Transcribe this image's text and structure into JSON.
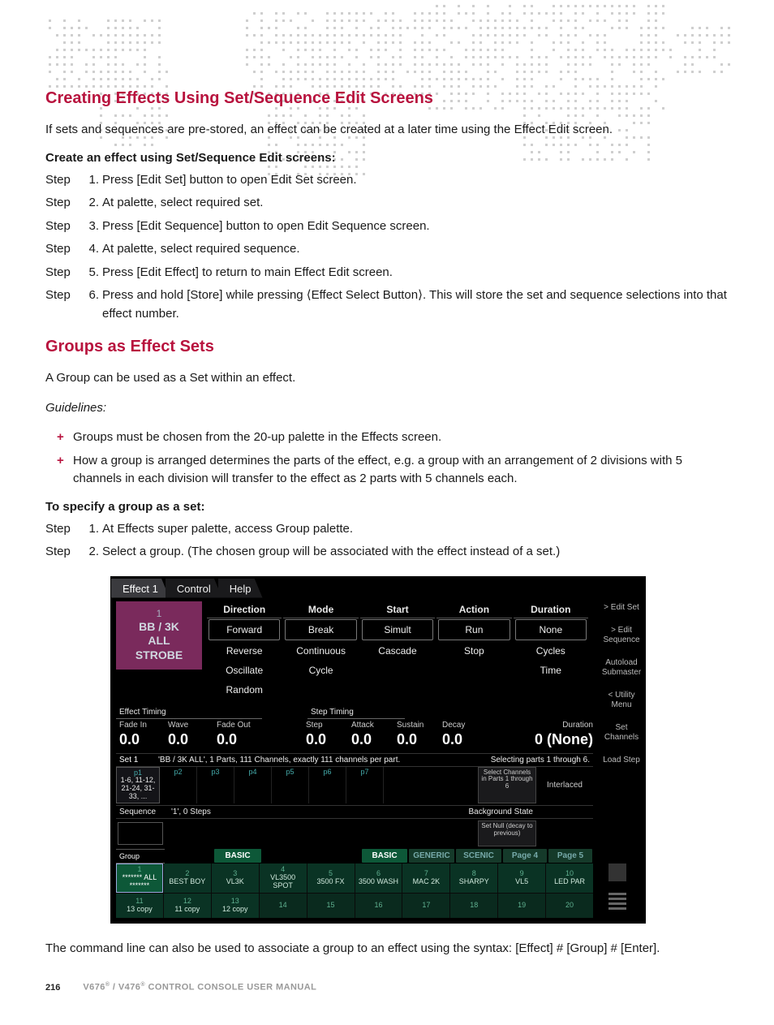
{
  "sections": {
    "h1": "Creating Effects Using Set/Sequence Edit Screens",
    "p1": "If sets and sequences are pre-stored, an effect can be created at a later time using the Effect Edit screen.",
    "sub1": "Create an effect using Set/Sequence Edit screens:",
    "steps1": [
      "Press [Edit Set] button to open Edit Set screen.",
      "At palette, select required set.",
      "Press [Edit Sequence] button to open Edit Sequence screen.",
      "At palette, select required sequence.",
      "Press [Edit Effect] to return to main Effect Edit screen.",
      "Press and hold [Store] while pressing ⟨Effect Select Button⟩. This will store the set and sequence selections into that effect number."
    ],
    "h2": "Groups as Effect Sets",
    "p2": "A Group can be used as a Set within an effect.",
    "guidelines_label": "Guidelines:",
    "bullets": [
      "Groups must be chosen from the 20-up palette in the Effects screen.",
      "How a group is arranged determines the parts of the effect, e.g. a group with an arrangement of 2 divisions with 5 channels in each division will transfer to the effect as 2 parts with 5 channels each."
    ],
    "sub2": "To specify a group as a set:",
    "steps2": [
      "At Effects super palette, access Group palette.",
      "Select a group. (The chosen group will be associated with the effect instead of a set.)"
    ],
    "closing": "The command line can also be used to associate a group to an effect using the syntax: [Effect] # [Group] # [Enter].",
    "step_label": "Step"
  },
  "shot": {
    "tabs": [
      "Effect 1",
      "Control",
      "Help"
    ],
    "effect_box": {
      "index": "1",
      "l1": "BB / 3K",
      "l2": "ALL",
      "l3": "STROBE"
    },
    "cols": {
      "Direction": [
        "Forward",
        "Reverse",
        "Oscillate",
        "Random"
      ],
      "Mode": [
        "Break",
        "Continuous",
        "Cycle"
      ],
      "Start": [
        "Simult",
        "Cascade"
      ],
      "Action": [
        "Run",
        "Stop"
      ],
      "Duration": [
        "None",
        "Cycles",
        "Time"
      ]
    },
    "side_menu": [
      "> Edit Set",
      "> Edit Sequence",
      "Autoload Submaster",
      "< Utility Menu",
      "Set Channels",
      "Load Step"
    ],
    "effect_timing_label": "Effect Timing",
    "step_timing_label": "Step Timing",
    "timing": {
      "fadein": {
        "l": "Fade In",
        "v": "0.0"
      },
      "wave": {
        "l": "Wave",
        "v": "0.0"
      },
      "fadeout": {
        "l": "Fade Out",
        "v": "0.0"
      },
      "step": {
        "l": "Step",
        "v": "0.0"
      },
      "attack": {
        "l": "Attack",
        "v": "0.0"
      },
      "sustain": {
        "l": "Sustain",
        "v": "0.0"
      },
      "decay": {
        "l": "Decay",
        "v": "0.0"
      },
      "duration": {
        "l": "Duration",
        "v": "0 (None)"
      }
    },
    "set": {
      "label": "Set 1",
      "desc": "'BB / 3K ALL', 1 Parts, 111 Channels, exactly 111 channels per part.",
      "sel": "Selecting parts 1 through 6.",
      "parts": [
        {
          "id": "p1",
          "text": "1-6, 11-12, 21-24, 31-33, ..."
        },
        {
          "id": "p2",
          "text": ""
        },
        {
          "id": "p3",
          "text": ""
        },
        {
          "id": "p4",
          "text": ""
        },
        {
          "id": "p5",
          "text": ""
        },
        {
          "id": "p6",
          "text": ""
        },
        {
          "id": "p7",
          "text": ""
        }
      ],
      "selbox": "Select Channels in Parts 1 through 6",
      "interlaced": "Interlaced"
    },
    "seq": {
      "label": "Sequence",
      "desc": "'1', 0 Steps",
      "bg": "Background State",
      "nullbox": "Set Null (decay to previous)"
    },
    "palette": {
      "group": "Group",
      "tags": [
        "BASIC",
        "",
        "",
        "BASIC",
        "GENERIC",
        "SCENIC",
        "Page 4",
        "Page 5"
      ],
      "cells": [
        {
          "n": "1",
          "t": "******* ALL *******",
          "sel": true
        },
        {
          "n": "2",
          "t": "BEST BOY"
        },
        {
          "n": "3",
          "t": "VL3K"
        },
        {
          "n": "4",
          "t": "VL3500 SPOT"
        },
        {
          "n": "5",
          "t": "3500 FX"
        },
        {
          "n": "6",
          "t": "3500 WASH"
        },
        {
          "n": "7",
          "t": "MAC 2K"
        },
        {
          "n": "8",
          "t": "SHARPY"
        },
        {
          "n": "9",
          "t": "VL5"
        },
        {
          "n": "10",
          "t": "LED PAR"
        },
        {
          "n": "11",
          "t": "13 copy"
        },
        {
          "n": "12",
          "t": "11 copy"
        },
        {
          "n": "13",
          "t": "12 copy"
        },
        {
          "n": "14",
          "t": ""
        },
        {
          "n": "15",
          "t": ""
        },
        {
          "n": "16",
          "t": ""
        },
        {
          "n": "17",
          "t": ""
        },
        {
          "n": "18",
          "t": ""
        },
        {
          "n": "19",
          "t": ""
        },
        {
          "n": "20",
          "t": ""
        }
      ]
    }
  },
  "footer": {
    "page": "216",
    "text": "V676® / V476® CONTROL CONSOLE USER MANUAL"
  }
}
